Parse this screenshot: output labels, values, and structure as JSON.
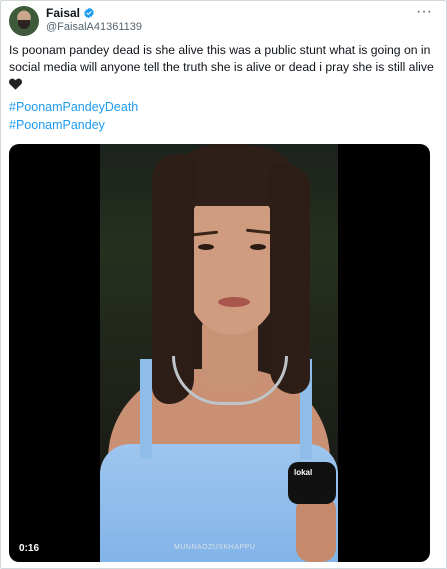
{
  "tweet": {
    "author_name": "Faisal",
    "author_handle": "@FaisalA41361139",
    "more_label": "···",
    "text": "Is poonam pandey dead is she alive this was a public stunt what is going on in social media will anyone tell the truth she is alive or dead i pray she is still alive",
    "hashtags": [
      "#PoonamPandeyDeath",
      "#PoonamPandey"
    ],
    "verified_color": "#1d9bf0",
    "hashtag_color": "#1d9bf0"
  },
  "video": {
    "duration": "0:16",
    "mic_text": "lokal",
    "watermark": "MUNNAOZUSKHAPPU"
  }
}
